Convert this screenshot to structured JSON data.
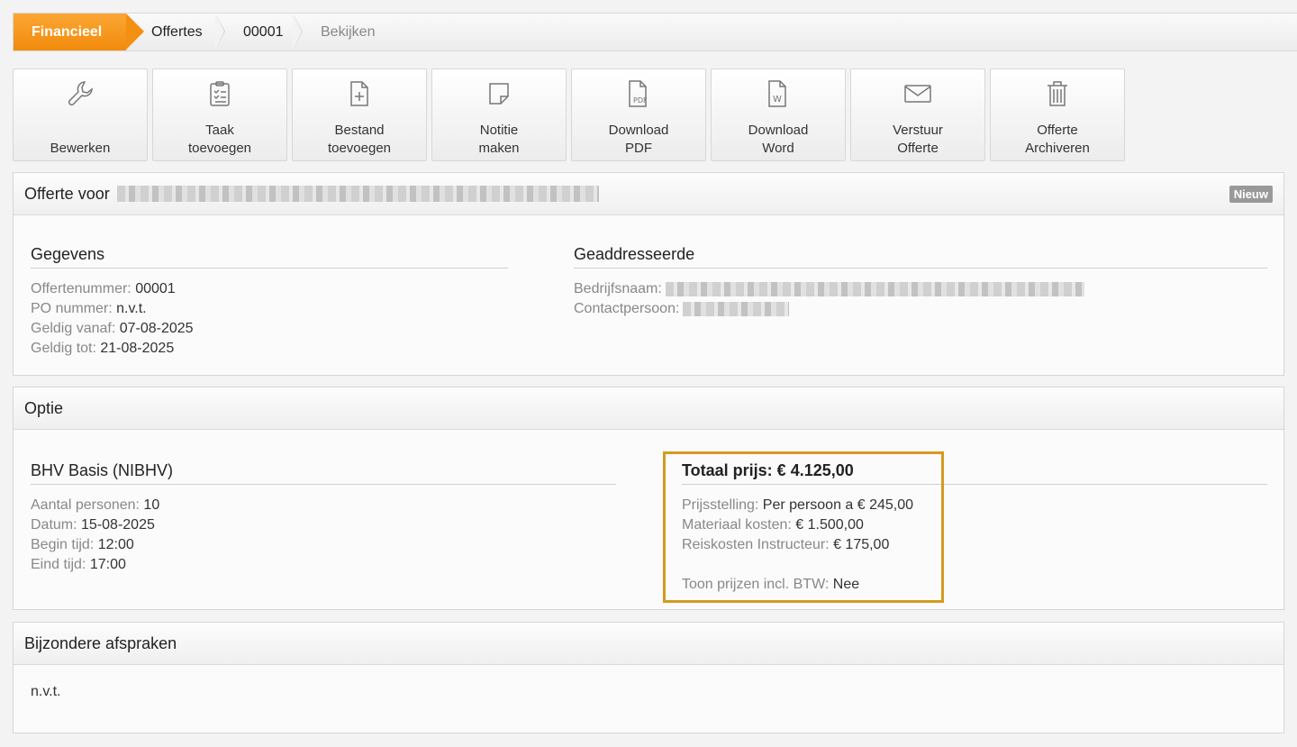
{
  "breadcrumb": {
    "items": [
      "Financieel",
      "Offertes",
      "00001",
      "Bekijken"
    ]
  },
  "toolbar": {
    "buttons": [
      {
        "label": "Bewerken",
        "icon": "wrench-icon"
      },
      {
        "label": "Taak\ntoevoegen",
        "icon": "clipboard-checklist-icon"
      },
      {
        "label": "Bestand\ntoevoegen",
        "icon": "file-add-icon"
      },
      {
        "label": "Notitie\nmaken",
        "icon": "note-icon"
      },
      {
        "label": "Download\nPDF",
        "icon": "pdf-file-icon"
      },
      {
        "label": "Download\nWord",
        "icon": "word-file-icon"
      },
      {
        "label": "Verstuur\nOfferte",
        "icon": "envelope-icon"
      },
      {
        "label": "Offerte\nArchiveren",
        "icon": "trash-icon"
      }
    ]
  },
  "offer": {
    "title": "Offerte voor",
    "status": "Nieuw",
    "gegevens": {
      "title": "Gegevens",
      "rows": [
        {
          "key": "Offertenummer:",
          "value": " 00001"
        },
        {
          "key": "PO nummer:",
          "value": " n.v.t."
        },
        {
          "key": "Geldig vanaf:",
          "value": " 07-08-2025"
        },
        {
          "key": "Geldig tot:",
          "value": " 21-08-2025"
        }
      ]
    },
    "geadresseerde": {
      "title": "Geaddresseerde",
      "rows": [
        {
          "key": "Bedrijfsnaam:"
        },
        {
          "key": "Contactpersoon:"
        }
      ]
    }
  },
  "optie": {
    "title": "Optie",
    "course": {
      "title": "BHV Basis (NIBHV)",
      "rows": [
        {
          "key": "Aantal personen:",
          "value": " 10"
        },
        {
          "key": "Datum:",
          "value": " 15-08-2025"
        },
        {
          "key": "Begin tijd:",
          "value": " 12:00"
        },
        {
          "key": "Eind tijd:",
          "value": " 17:00"
        }
      ]
    },
    "price": {
      "title": "Totaal prijs: € 4.125,00",
      "rows": [
        {
          "key": "Prijsstelling:",
          "value": " Per persoon a € 245,00"
        },
        {
          "key": "Materiaal kosten:",
          "value": " € 1.500,00"
        },
        {
          "key": "Reiskosten Instructeur:",
          "value": " € 175,00"
        }
      ],
      "btw": {
        "key": "Toon prijzen incl. BTW:",
        "value": " Nee"
      }
    }
  },
  "afspraken": {
    "title": "Bijzondere afspraken",
    "text": "n.v.t."
  },
  "colors": {
    "accent": "#f39012",
    "highlight": "#d59a1f"
  }
}
